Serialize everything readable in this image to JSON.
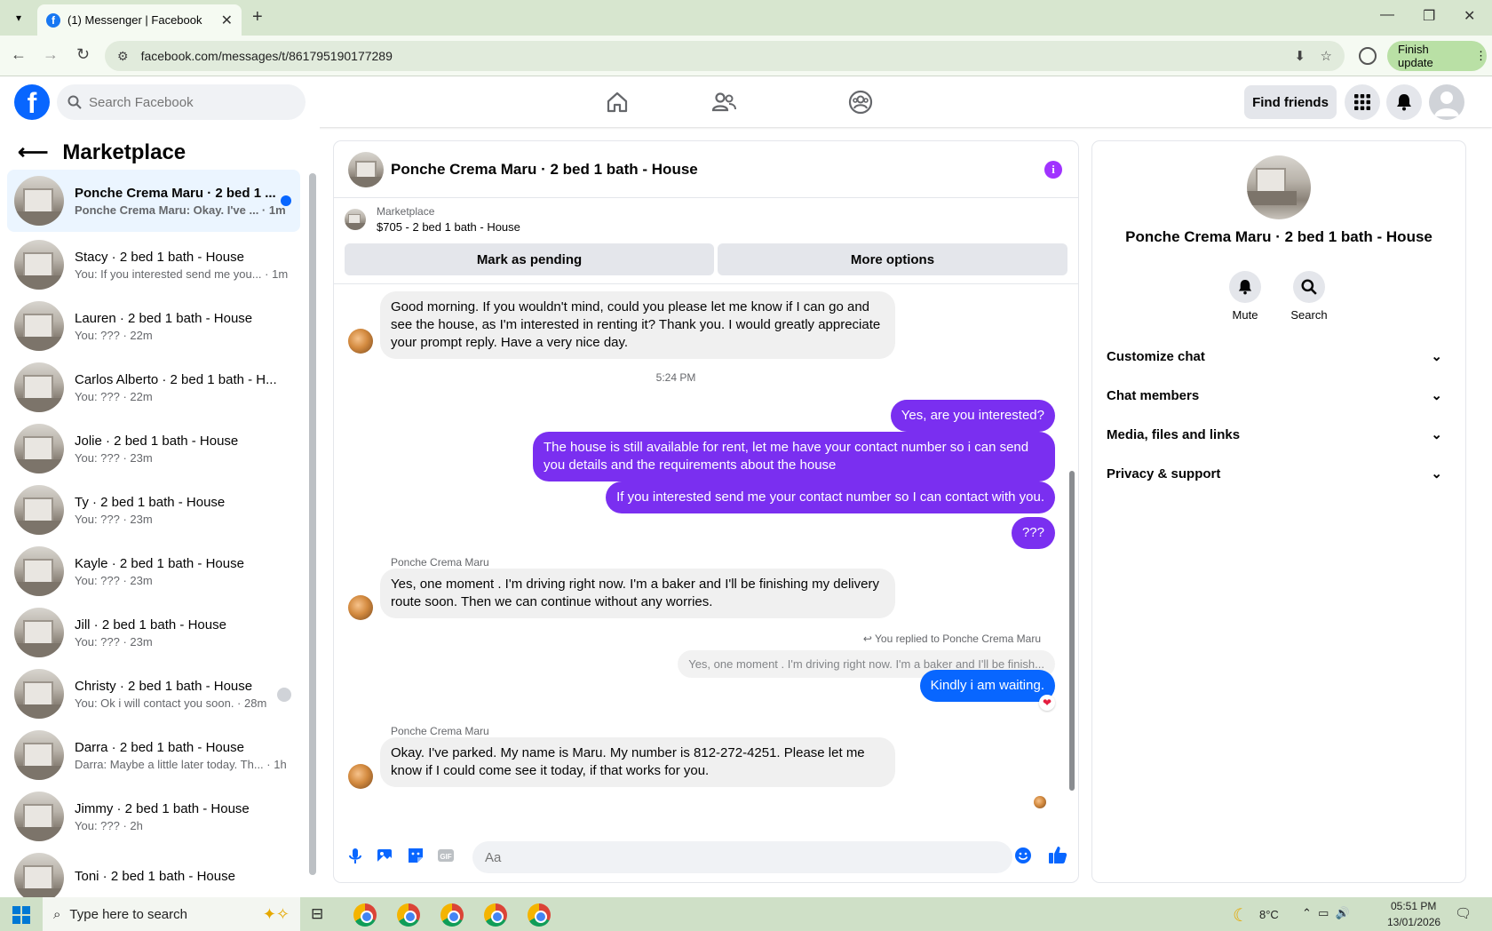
{
  "browser": {
    "tab_title": "(1) Messenger | Facebook",
    "url": "facebook.com/messages/t/861795190177289",
    "finish_update": "Finish update"
  },
  "header": {
    "search_placeholder": "Search Facebook",
    "find_friends": "Find friends"
  },
  "sidebar": {
    "title": "Marketplace",
    "conversations": [
      {
        "name": "Ponche Crema Maru · 2 bed 1 ...",
        "preview": "Ponche Crema Maru: Okay. I've ... · 1m",
        "unread": true
      },
      {
        "name": "Stacy · 2 bed 1 bath - House",
        "preview": "You: If you interested send me you... · 1m"
      },
      {
        "name": "Lauren · 2 bed 1 bath - House",
        "preview": "You: ??? · 22m"
      },
      {
        "name": "Carlos Alberto · 2 bed 1 bath - H...",
        "preview": "You: ??? · 22m"
      },
      {
        "name": "Jolie · 2 bed 1 bath - House",
        "preview": "You: ??? · 23m"
      },
      {
        "name": "Ty · 2 bed 1 bath - House",
        "preview": "You: ??? · 23m"
      },
      {
        "name": "Kayle · 2 bed 1 bath - House",
        "preview": "You: ??? · 23m"
      },
      {
        "name": "Jill · 2 bed 1 bath - House",
        "preview": "You: ??? · 23m"
      },
      {
        "name": "Christy · 2 bed 1 bath - House",
        "preview": "You: Ok i will contact you soon. · 28m"
      },
      {
        "name": "Darra · 2 bed 1 bath - House",
        "preview": "Darra: Maybe a little later today. Th... · 1h"
      },
      {
        "name": "Jimmy · 2 bed 1 bath - House",
        "preview": "You: ??? · 2h"
      },
      {
        "name": "Toni · 2 bed 1 bath - House",
        "preview": ""
      }
    ]
  },
  "chat": {
    "title": "Ponche Crema Maru · 2 bed 1 bath - House",
    "marketplace_label": "Marketplace",
    "listing": "$705 - 2 bed 1 bath - House",
    "mark_pending": "Mark as pending",
    "more_options": "More options",
    "messages": {
      "m1": "Good morning. If you wouldn't mind, could you please let me know if I can go and see the house, as I'm interested in renting it? Thank you. I would greatly appreciate your prompt reply. Have a very nice day.",
      "time": "5:24 PM",
      "m2": "Yes, are you interested?",
      "m3": "The house is still available for rent, let me have your contact number so i can send you details and the requirements about the house",
      "m4": "If you interested send me your contact number so I can contact with you.",
      "m5": "???",
      "sender": "Ponche Crema Maru",
      "m6": "Yes, one moment  . I'm driving right now. I'm a baker and I'll be finishing my delivery route soon. Then we can continue without any worries.",
      "reply_label": "You replied to Ponche Crema Maru",
      "quoted": "Yes, one moment  . I'm driving right now. I'm a baker and I'll be finish...",
      "m7": "Kindly i am waiting.",
      "m8": "Okay. I've parked. My name is Maru. My number is 812-272-4251. Please let me know if I could come see it today, if that works for you."
    },
    "input_placeholder": "Aa"
  },
  "details": {
    "name": "Ponche Crema Maru · 2 bed 1 bath - House",
    "mute": "Mute",
    "search": "Search",
    "sections": [
      "Customize chat",
      "Chat members",
      "Media, files and links",
      "Privacy & support"
    ]
  },
  "taskbar": {
    "search_text": "Type here to search",
    "temp": "8°C",
    "time": "05:51 PM",
    "date": "13/01/2026"
  }
}
